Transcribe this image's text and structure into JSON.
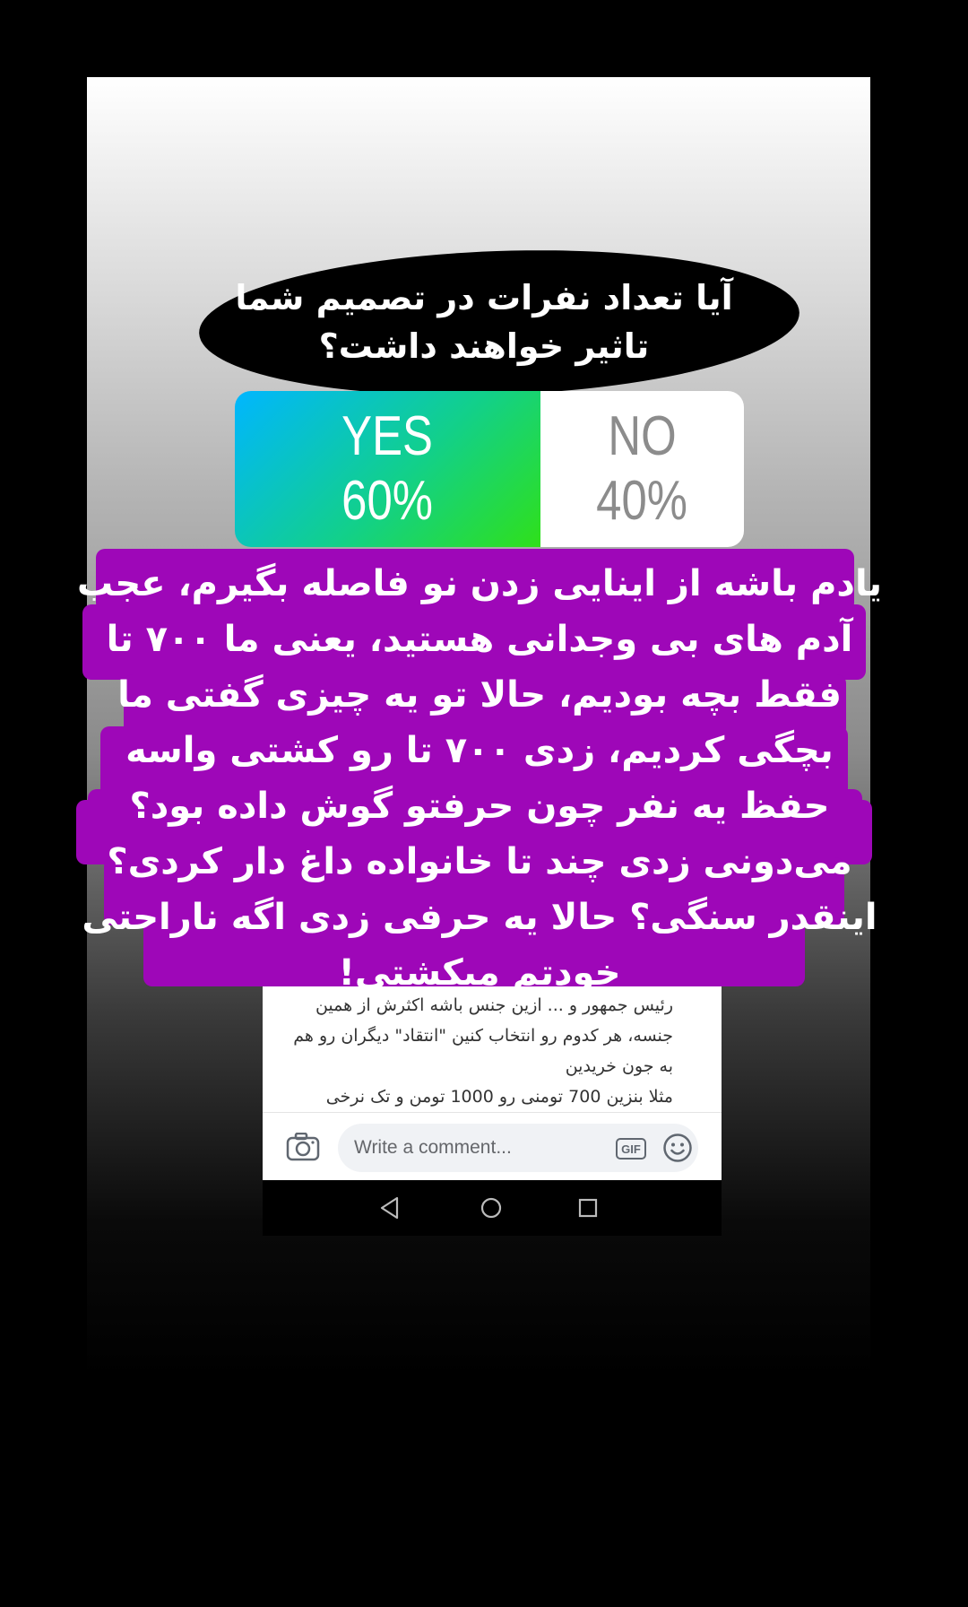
{
  "story": {
    "question": "آیا تعداد نفرات در تصمیم شما تاثیر خواهند داشت؟",
    "poll": {
      "options": [
        {
          "label": "YES",
          "percent_text": "60%",
          "percent": 60
        },
        {
          "label": "NO",
          "percent_text": "40%",
          "percent": 40
        }
      ]
    },
    "caption": "یادم باشه از اینایی زدن نو فاصله بگیرم، عجب آدم های بی وجدانی هستید، یعنی ما ۷۰۰ تا فقط بچه بودیم، حالا تو یه چیزی گفتی ما بچگی کردیم، زدی ۷۰۰ تا رو کشتی واسه حفظ یه نفر چون حرفتو گوش داده بود؟ می‌دونی زدی چند تا خانواده داغ دار کردی؟ اینقدر سنگی؟ حالا یه حرفی زدی اگه ناراحتی خودتم میکشتی!"
  },
  "screenshot": {
    "post_lines": [
      "رئیس جمهور و ... ازین جنس باشه اکثرش از همین",
      "جنسه، هر کدوم رو انتخاب کنین \"انتقاد\" دیگران رو هم",
      "به جون خریدین",
      "مثلا بنزین 700 تومنی رو 1000 تومن و تک نرخی"
    ],
    "comment_placeholder": "Write a comment...",
    "gif_label": "GIF",
    "icons": {
      "camera": "camera-icon",
      "gif": "gif-icon",
      "emoji": "emoji-icon",
      "back": "nav-back-icon",
      "home": "nav-home-icon",
      "recent": "nav-recent-icon"
    }
  },
  "colors": {
    "caption_bg": "#9e07b8",
    "poll_yes_from": "#00b6ff",
    "poll_yes_to": "#2fe01a",
    "poll_no_text": "#8c8c8c"
  }
}
